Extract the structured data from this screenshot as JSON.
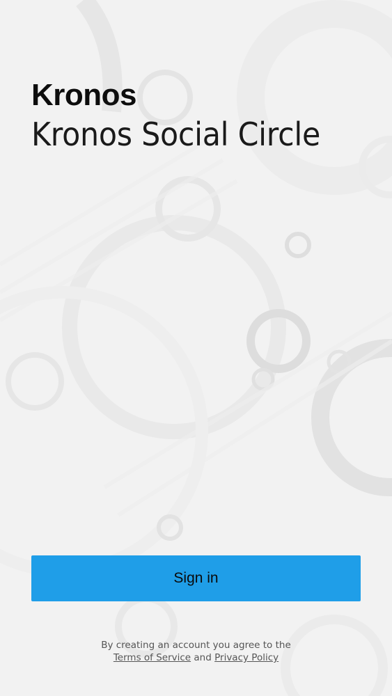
{
  "header": {
    "app_name": "Kronos",
    "subtitle": "Kronos Social Circle"
  },
  "actions": {
    "sign_in_label": "Sign in"
  },
  "legal": {
    "line1": "By creating an account you agree to the",
    "terms_label": "Terms of Service",
    "conjunction": "and",
    "privacy_label": "Privacy Policy"
  },
  "colors": {
    "accent": "#1f9ee8",
    "background": "#f3f3f3",
    "text_primary": "#0d0d0d",
    "text_muted": "#555555"
  }
}
